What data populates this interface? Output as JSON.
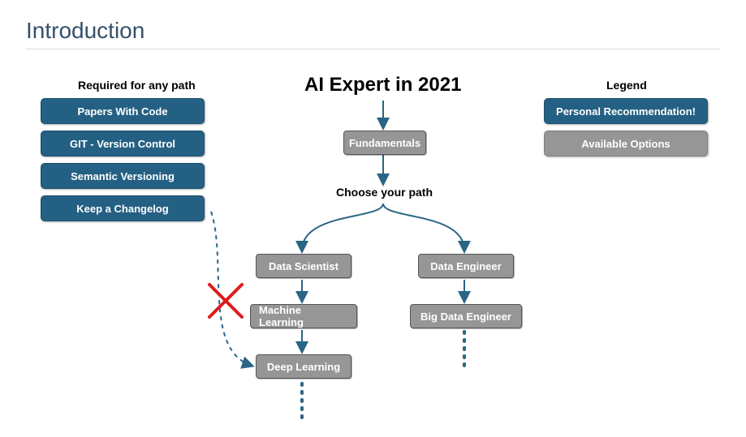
{
  "page": {
    "title": "Introduction"
  },
  "left_panel": {
    "heading": "Required for any path",
    "items": [
      {
        "label": "Papers With Code"
      },
      {
        "label": "GIT - Version Control"
      },
      {
        "label": "Semantic Versioning"
      },
      {
        "label": "Keep a Changelog"
      }
    ]
  },
  "legend": {
    "heading": "Legend",
    "items": [
      {
        "label": "Personal Recommendation!",
        "style": "blue"
      },
      {
        "label": "Available Options",
        "style": "grey"
      }
    ]
  },
  "diagram": {
    "title": "AI Expert in 2021",
    "root": "Fundamentals",
    "choose_text": "Choose your path",
    "left_path": [
      "Data Scientist",
      "Machine Learning",
      "Deep Learning"
    ],
    "right_path": [
      "Data Engineer",
      "Big Data Engineer"
    ]
  },
  "colors": {
    "accent": "#246083",
    "node_grey": "#969696",
    "red": "#dd1c1c"
  }
}
